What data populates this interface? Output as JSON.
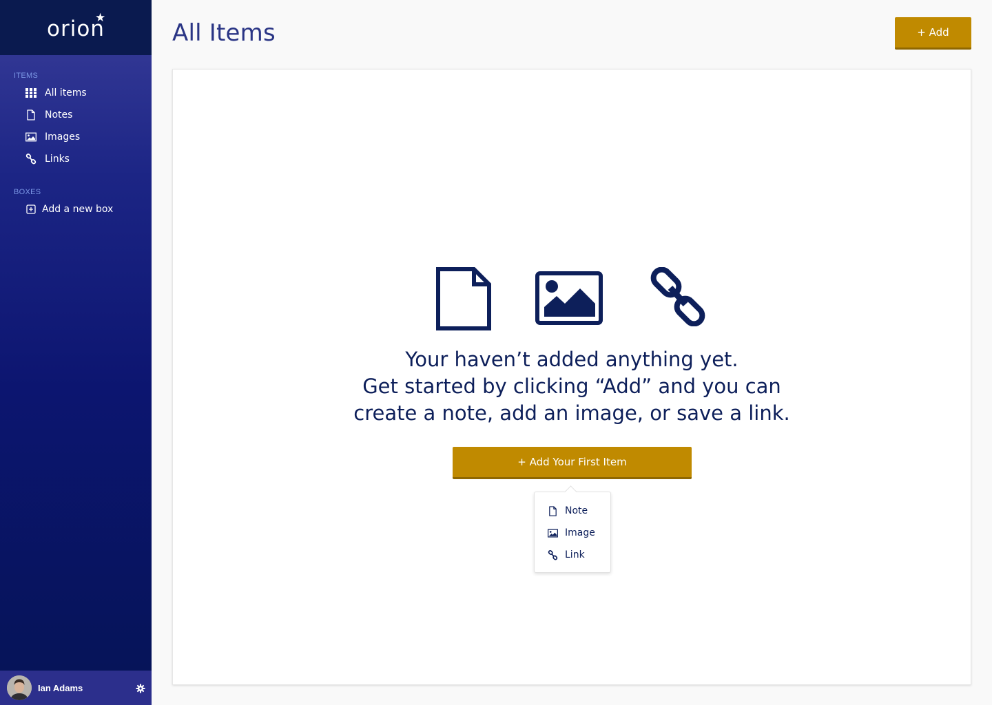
{
  "brand": {
    "name": "orion"
  },
  "sidebar": {
    "items_section": "ITEMS",
    "items": [
      {
        "label": "All items",
        "icon": "grid-icon"
      },
      {
        "label": "Notes",
        "icon": "note-icon"
      },
      {
        "label": "Images",
        "icon": "image-icon"
      },
      {
        "label": "Links",
        "icon": "link-icon"
      }
    ],
    "boxes_section": "BOXES",
    "boxes": [
      {
        "label": "Add a new box",
        "icon": "plus-square-icon"
      }
    ]
  },
  "user": {
    "name": "Ian Adams"
  },
  "header": {
    "title": "All Items",
    "add_label": "+ Add"
  },
  "empty_state": {
    "lines": [
      "Your haven’t added anything yet.",
      "Get started by clicking “Add” and you can",
      "create a note, add an image, or save a link."
    ],
    "cta_label": "+ Add Your First Item"
  },
  "dropdown": {
    "items": [
      {
        "label": "Note",
        "icon": "note-icon"
      },
      {
        "label": "Image",
        "icon": "image-icon"
      },
      {
        "label": "Link",
        "icon": "link-icon"
      }
    ]
  },
  "colors": {
    "accent_gold": "#c08a00",
    "navy_text": "#0d1f5a",
    "title_blue": "#2a3585",
    "sidebar_top": "#0a1a4f"
  }
}
